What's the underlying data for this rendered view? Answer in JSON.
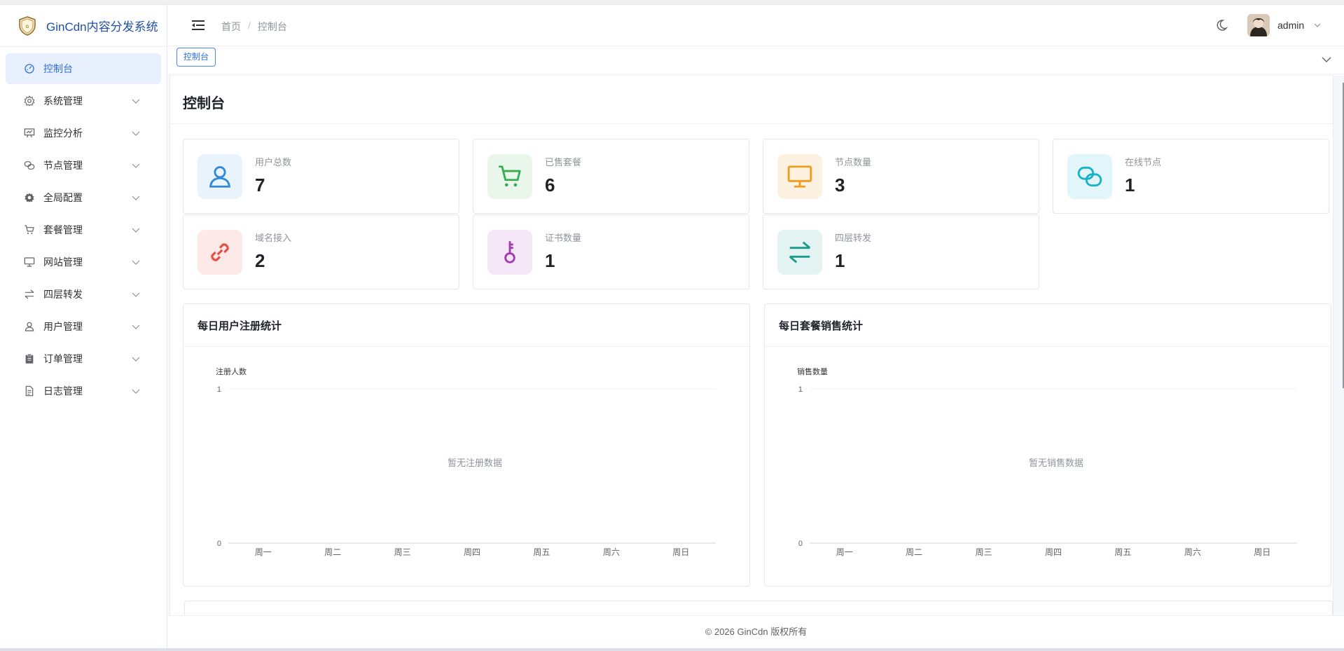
{
  "app": {
    "title": "GinCdn内容分发系统"
  },
  "sidebar": {
    "items": [
      {
        "label": "控制台",
        "icon": "dashboard-icon",
        "active": true
      },
      {
        "label": "系统管理",
        "icon": "gear-icon"
      },
      {
        "label": "监控分析",
        "icon": "monitor-chart-icon"
      },
      {
        "label": "节点管理",
        "icon": "link-nodes-icon"
      },
      {
        "label": "全局配置",
        "icon": "cog-filled-icon"
      },
      {
        "label": "套餐管理",
        "icon": "cart-icon"
      },
      {
        "label": "网站管理",
        "icon": "monitor-icon"
      },
      {
        "label": "四层转发",
        "icon": "transfer-icon"
      },
      {
        "label": "用户管理",
        "icon": "user-icon"
      },
      {
        "label": "订单管理",
        "icon": "clipboard-icon"
      },
      {
        "label": "日志管理",
        "icon": "document-icon"
      }
    ]
  },
  "header": {
    "breadcrumb": [
      "首页",
      "控制台"
    ],
    "breadcrumb_sep": "/",
    "username": "admin"
  },
  "tags": {
    "active_tag": "控制台"
  },
  "page": {
    "title": "控制台"
  },
  "stats": [
    {
      "label": "用户总数",
      "value": "7",
      "icon": "user-icon",
      "color": "#2f89d8",
      "bg": "#e8f3fc"
    },
    {
      "label": "已售套餐",
      "value": "6",
      "icon": "cart-icon",
      "color": "#3bab52",
      "bg": "#e9f6ec"
    },
    {
      "label": "节点数量",
      "value": "3",
      "icon": "monitor-icon",
      "color": "#f29c1f",
      "bg": "#fdf1e2"
    },
    {
      "label": "在线节点",
      "value": "1",
      "icon": "link-icon",
      "color": "#17b1c8",
      "bg": "#e2f6f9"
    },
    {
      "label": "域名接入",
      "value": "2",
      "icon": "chain-link-icon",
      "color": "#ea4c42",
      "bg": "#fde9e8"
    },
    {
      "label": "证书数量",
      "value": "1",
      "icon": "key-icon",
      "color": "#a03db1",
      "bg": "#f4e6f6"
    },
    {
      "label": "四层转发",
      "value": "1",
      "icon": "transfer-icon",
      "color": "#1b9a8a",
      "bg": "#e2f3f1"
    }
  ],
  "charts": {
    "registrations": {
      "title": "每日用户注册统计",
      "empty_text": "暂无注册数据"
    },
    "sales": {
      "title": "每日套餐销售统计",
      "empty_text": "暂无销售数据"
    }
  },
  "chart_data": [
    {
      "type": "line",
      "title": "每日用户注册统计",
      "ylabel": "注册人数",
      "categories": [
        "周一",
        "周二",
        "周三",
        "周四",
        "周五",
        "周六",
        "周日"
      ],
      "series": [],
      "ylim": [
        0,
        1
      ],
      "yticks": [
        "0",
        "1"
      ],
      "grid": true
    },
    {
      "type": "line",
      "title": "每日套餐销售统计",
      "ylabel": "销售数量",
      "categories": [
        "周一",
        "周二",
        "周三",
        "周四",
        "周五",
        "周六",
        "周日"
      ],
      "series": [],
      "ylim": [
        0,
        1
      ],
      "yticks": [
        "0",
        "1"
      ],
      "grid": true
    }
  ],
  "footer": {
    "text": "© 2026 GinCdn 版权所有"
  }
}
